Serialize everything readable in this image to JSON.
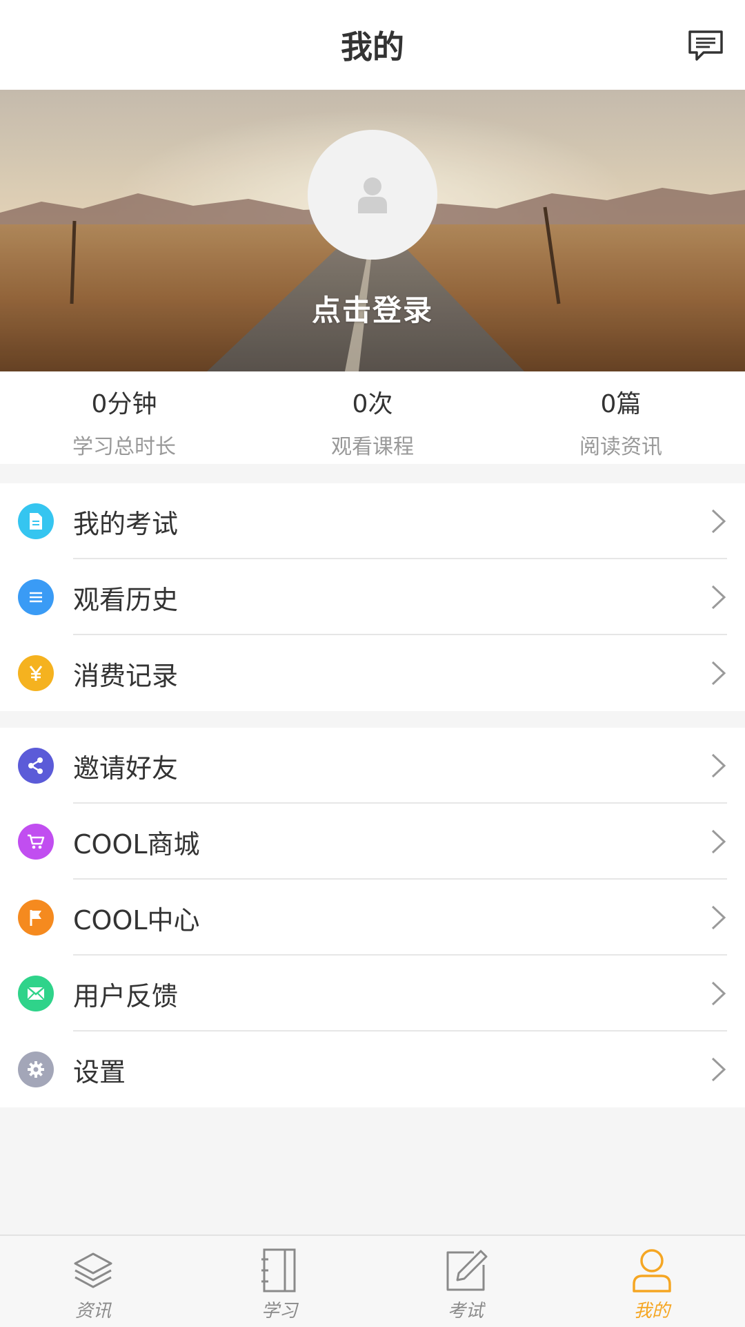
{
  "header": {
    "title": "我的",
    "message_icon": "message-icon"
  },
  "profile": {
    "avatar_icon": "user-placeholder-icon",
    "login_text": "点击登录"
  },
  "stats": [
    {
      "value": "0分钟",
      "label": "学习总时长"
    },
    {
      "value": "0次",
      "label": "观看课程"
    },
    {
      "value": "0篇",
      "label": "阅读资讯"
    }
  ],
  "menu_group_1": [
    {
      "label": "我的考试",
      "icon": "document-icon",
      "color": "#35c5f0"
    },
    {
      "label": "观看历史",
      "icon": "list-icon",
      "color": "#3a9bf5"
    },
    {
      "label": "消费记录",
      "icon": "yen-icon",
      "color": "#f5b21f"
    }
  ],
  "menu_group_2": [
    {
      "label": "邀请好友",
      "icon": "share-icon",
      "color": "#5b5bd8"
    },
    {
      "label": "COOL商城",
      "icon": "cart-icon",
      "color": "#c14ef0"
    },
    {
      "label": "COOL中心",
      "icon": "flag-icon",
      "color": "#f58a1f"
    },
    {
      "label": "用户反馈",
      "icon": "mail-icon",
      "color": "#2fd38a"
    },
    {
      "label": "设置",
      "icon": "gear-icon",
      "color": "#a3a6b8"
    }
  ],
  "tabs": [
    {
      "label": "资讯",
      "icon": "layers-icon",
      "active": false
    },
    {
      "label": "学习",
      "icon": "notebook-icon",
      "active": false
    },
    {
      "label": "考试",
      "icon": "edit-icon",
      "active": false
    },
    {
      "label": "我的",
      "icon": "user-icon",
      "active": true
    }
  ],
  "colors": {
    "accent": "#f5a623",
    "inactive": "#8a8a8a"
  }
}
